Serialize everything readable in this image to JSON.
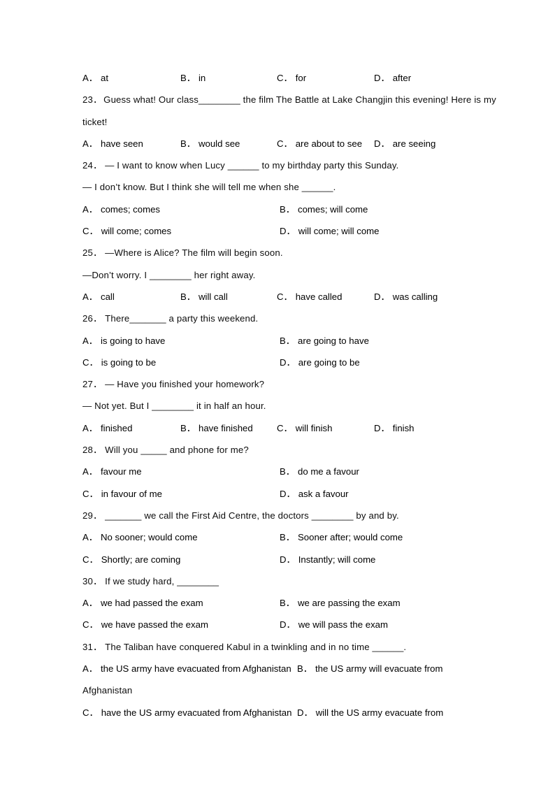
{
  "document": {
    "type": "english-grammar-multiple-choice-worksheet",
    "visible_question_range": "22 (options only) through 31"
  },
  "lines": [
    {
      "id": "q22-options",
      "kind": "options4",
      "options": [
        {
          "label": "A",
          "text": "at"
        },
        {
          "label": "B",
          "text": "in"
        },
        {
          "label": "C",
          "text": "for"
        },
        {
          "label": "D",
          "text": "after"
        }
      ]
    },
    {
      "id": "q23-stem-1",
      "kind": "text",
      "number": "23",
      "text": "Guess what! Our class________ the film The Battle at Lake Changjin this evening! Here is my"
    },
    {
      "id": "q23-stem-2",
      "kind": "text",
      "text": "ticket!"
    },
    {
      "id": "q23-options",
      "kind": "options4",
      "options": [
        {
          "label": "A",
          "text": "have seen"
        },
        {
          "label": "B",
          "text": "would see"
        },
        {
          "label": "C",
          "text": "are about to see"
        },
        {
          "label": "D",
          "text": "are seeing"
        }
      ]
    },
    {
      "id": "q24-stem-1",
      "kind": "text",
      "number": "24",
      "text": "— I want to know when Lucy ______ to my birthday party this Sunday."
    },
    {
      "id": "q24-stem-2",
      "kind": "text",
      "text": "— I don’t know. But I think she will tell me when she ______."
    },
    {
      "id": "q24-options-ab",
      "kind": "options2",
      "options": [
        {
          "label": "A",
          "text": "comes; comes"
        },
        {
          "label": "B",
          "text": "comes; will come"
        }
      ]
    },
    {
      "id": "q24-options-cd",
      "kind": "options2",
      "options": [
        {
          "label": "C",
          "text": "will come; comes"
        },
        {
          "label": "D",
          "text": "will come; will come"
        }
      ]
    },
    {
      "id": "q25-stem-1",
      "kind": "text",
      "number": "25",
      "text": "—Where is Alice? The film will begin soon."
    },
    {
      "id": "q25-stem-2",
      "kind": "text",
      "text": "—Don’t worry. I ________ her right away."
    },
    {
      "id": "q25-options",
      "kind": "options4",
      "options": [
        {
          "label": "A",
          "text": "call"
        },
        {
          "label": "B",
          "text": "will call"
        },
        {
          "label": "C",
          "text": "have called"
        },
        {
          "label": "D",
          "text": "was calling"
        }
      ]
    },
    {
      "id": "q26-stem",
      "kind": "text",
      "number": "26",
      "text": "There_______ a party this weekend."
    },
    {
      "id": "q26-options-ab",
      "kind": "options2",
      "options": [
        {
          "label": "A",
          "text": "is going to have"
        },
        {
          "label": "B",
          "text": "are going to have"
        }
      ]
    },
    {
      "id": "q26-options-cd",
      "kind": "options2",
      "options": [
        {
          "label": "C",
          "text": "is going to be"
        },
        {
          "label": "D",
          "text": "are going to be"
        }
      ]
    },
    {
      "id": "q27-stem-1",
      "kind": "text",
      "number": "27",
      "text": "— Have you finished your homework?"
    },
    {
      "id": "q27-stem-2",
      "kind": "text",
      "text": "— Not yet. But I ________ it in half an hour."
    },
    {
      "id": "q27-options",
      "kind": "options4",
      "options": [
        {
          "label": "A",
          "text": "finished"
        },
        {
          "label": "B",
          "text": "have finished"
        },
        {
          "label": "C",
          "text": "will finish"
        },
        {
          "label": "D",
          "text": "finish"
        }
      ]
    },
    {
      "id": "q28-stem",
      "kind": "text",
      "number": "28",
      "text": "Will you _____ and phone for me?"
    },
    {
      "id": "q28-options-ab",
      "kind": "options2",
      "options": [
        {
          "label": "A",
          "text": "favour me"
        },
        {
          "label": "B",
          "text": "do me a favour"
        }
      ]
    },
    {
      "id": "q28-options-cd",
      "kind": "options2",
      "options": [
        {
          "label": "C",
          "text": "in favour of me"
        },
        {
          "label": "D",
          "text": "ask a favour"
        }
      ]
    },
    {
      "id": "q29-stem",
      "kind": "text",
      "number": "29",
      "text": "_______ we call the First Aid Centre, the doctors ________ by and by."
    },
    {
      "id": "q29-options-ab",
      "kind": "options2",
      "options": [
        {
          "label": "A",
          "text": "No sooner; would come"
        },
        {
          "label": "B",
          "text": "Sooner after; would come"
        }
      ]
    },
    {
      "id": "q29-options-cd",
      "kind": "options2",
      "options": [
        {
          "label": "C",
          "text": "Shortly; are coming"
        },
        {
          "label": "D",
          "text": "Instantly; will come"
        }
      ]
    },
    {
      "id": "q30-stem",
      "kind": "text",
      "number": "30",
      "text": "If we study hard, ________"
    },
    {
      "id": "q30-options-ab",
      "kind": "options2",
      "options": [
        {
          "label": "A",
          "text": "we had passed the exam"
        },
        {
          "label": "B",
          "text": "we are passing the exam"
        }
      ]
    },
    {
      "id": "q30-options-cd",
      "kind": "options2",
      "options": [
        {
          "label": "C",
          "text": "we have passed the exam"
        },
        {
          "label": "D",
          "text": "we will pass the exam"
        }
      ]
    },
    {
      "id": "q31-stem",
      "kind": "text",
      "number": "31",
      "text": "The Taliban have conquered Kabul in a twinkling and in no time ______."
    },
    {
      "id": "q31-options-ab",
      "kind": "options2wide",
      "options": [
        {
          "label": "A",
          "text": "the US army have evacuated from Afghanistan"
        },
        {
          "label": "B",
          "text": "the US army will evacuate from"
        }
      ]
    },
    {
      "id": "q31-options-b-cont",
      "kind": "text",
      "text": "Afghanistan"
    },
    {
      "id": "q31-options-cd",
      "kind": "options2wide",
      "options": [
        {
          "label": "C",
          "text": "have the US army evacuated from Afghanistan"
        },
        {
          "label": "D",
          "text": "will the US army evacuate from"
        }
      ]
    }
  ]
}
